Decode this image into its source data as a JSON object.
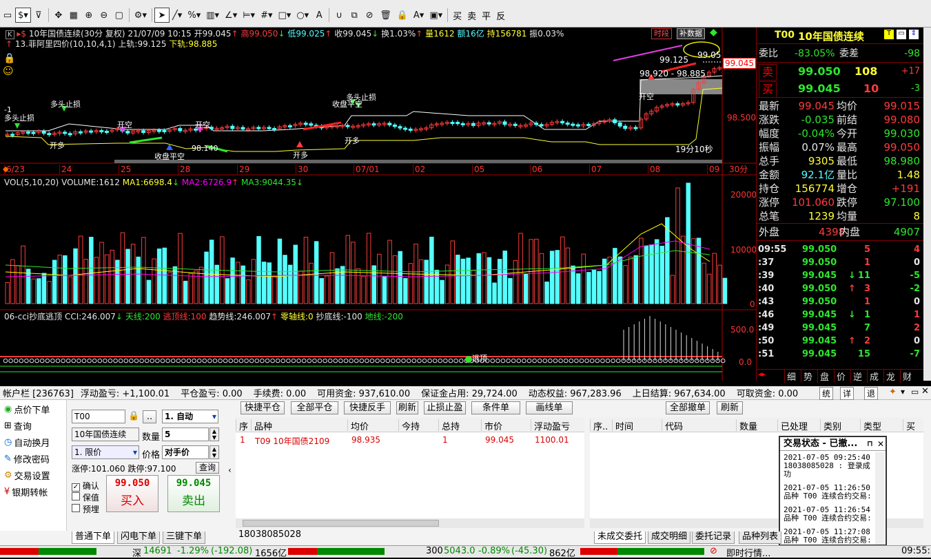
{
  "toolbar": {
    "texts": [
      "买",
      "卖",
      "平",
      "反"
    ]
  },
  "chart": {
    "title_code": "10年国债连续(30分 复权)",
    "date": "21/07/09 10:15",
    "open_lbl": "开99.045",
    "high_lbl": "高99.050",
    "low_lbl": "低99.025",
    "close_lbl": "收99.045",
    "turnover": "换1.03%",
    "vol": "量1612",
    "amount": "额16亿",
    "oi": "持156781",
    "amp": "振0.03%",
    "line2_title": "13.菲阿里四价(10,10,4,1)",
    "upper": "上轨:99.125",
    "lower": "下轨:98.885",
    "btn_timeshare": "时段",
    "btn_supplement": "补数据",
    "price_labels": [
      "99.045",
      "98.500"
    ],
    "labels_top": [
      "99.125",
      "99.05",
      "98.920 - 98.885"
    ],
    "countdown": "19分10秒",
    "dates": [
      "6/23",
      "24",
      "25",
      "28",
      "29",
      "30",
      "07/01",
      "02",
      "05",
      "06",
      "07",
      "08",
      "09"
    ],
    "period": "30分",
    "vol_title": "VOL(5,10,20) VOLUME:1612",
    "ma1": "MA1:6698.4",
    "ma2": "MA2:6726.9",
    "ma3": "MA3:9044.35",
    "vol_axis": [
      "20000",
      "10000",
      "0"
    ],
    "cci_title": "06-cci抄底逃顶 CCI:246.007",
    "cci_sky": "天线:200",
    "cci_escape": "逃顶线:100",
    "cci_trend": "趋势线:246.007",
    "cci_zero": "零轴线:0",
    "cci_bottom": "抄底线:-100",
    "cci_ground": "地线:-200",
    "cci_axis": [
      "500.0",
      "0.0"
    ],
    "signals": [
      "-1",
      "多头止损",
      "多头止损",
      "开空",
      "开空",
      "开多",
      "开多",
      "收盘平空",
      "开多",
      "收盘平空",
      "多头止损",
      "开空",
      "98.140",
      "开空",
      "收盘平空"
    ],
    "cci_mark": "逃顶"
  },
  "quote": {
    "code": "T00",
    "name": "10年国债连续",
    "weibi_lbl": "委比",
    "weibi": "-83.05%",
    "weicha_lbl": "委差",
    "weicha": "-98",
    "sell_lbl": "卖",
    "sell_price": "99.050",
    "sell_vol": "108",
    "sell_chg": "+17",
    "buy_lbl": "买",
    "buy_price": "99.045",
    "buy_vol": "10",
    "buy_chg": "-3",
    "rows": [
      [
        "最新",
        "99.045",
        "均价",
        "99.015"
      ],
      [
        "涨跌",
        "-0.035",
        "前结",
        "99.080"
      ],
      [
        "幅度",
        "-0.04%",
        "今开",
        "99.030"
      ],
      [
        "振幅",
        "0.07%",
        "最高",
        "99.050"
      ],
      [
        "总手",
        "9305",
        "最低",
        "98.980"
      ],
      [
        "金额",
        "92.1亿",
        "量比",
        "1.48"
      ],
      [
        "持仓",
        "156774",
        "增仓",
        "+191"
      ],
      [
        "涨停",
        "101.060",
        "跌停",
        "97.100"
      ],
      [
        "总笔",
        "1239",
        "均量",
        "8"
      ]
    ],
    "outer_lbl": "外盘",
    "outer": "4398",
    "inner_lbl": "内盘",
    "inner": "4907",
    "ticks": [
      [
        "09:55",
        "99.050",
        "",
        "5",
        "4"
      ],
      [
        ":37",
        "99.050",
        "",
        "1",
        "0"
      ],
      [
        ":39",
        "99.045",
        "↓",
        "11",
        "-5"
      ],
      [
        ":40",
        "99.050",
        "↑",
        "3",
        "-2"
      ],
      [
        ":43",
        "99.050",
        "",
        "1",
        "0"
      ],
      [
        ":46",
        "99.045",
        "↓",
        "1",
        "1"
      ],
      [
        ":49",
        "99.045",
        "",
        "7",
        "2"
      ],
      [
        ":50",
        "99.045",
        "↑",
        "2",
        "0"
      ],
      [
        ":51",
        "99.045",
        "",
        "15",
        "-7"
      ]
    ],
    "tabs": [
      "细",
      "势",
      "盘",
      "价",
      "逆",
      "成",
      "龙",
      "财"
    ]
  },
  "account": {
    "label": "帐户栏 [236763]",
    "float_pl": "浮动盈亏: +1,100.01",
    "close_pl": "平仓盈亏: 0.00",
    "fee": "手续费: 0.00",
    "avail": "可用资金: 937,610.00",
    "margin": "保证金占用: 29,724.00",
    "equity": "动态权益: 967,283.96",
    "last_settle": "上日结算: 967,634.00",
    "withdraw": "可取资金: 0.00",
    "btns": [
      "统",
      "详",
      "退"
    ]
  },
  "nav": [
    "点价下单",
    "查询",
    "自动换月",
    "修改密码",
    "交易设置",
    "银期转帐"
  ],
  "order": {
    "code": "T00",
    "auto": "1. 自动",
    "name": "10年国债连续",
    "qty_lbl": "数量",
    "qty": "5",
    "type": "1. 限价",
    "price_lbl": "价格",
    "price": "对手价",
    "limits": "涨停:101.060 跌停:97.100",
    "query": "查询",
    "buy_price": "99.050",
    "buy_lbl": "买入",
    "sell_price": "99.045",
    "sell_lbl": "卖出",
    "chk_confirm": "确认",
    "chk_keep": "保值",
    "chk_pre": "预埋",
    "tabs": [
      "普通下单",
      "闪电下单",
      "三键下单"
    ]
  },
  "position": {
    "btns": [
      "快捷平仓",
      "全部平仓",
      "快捷反手",
      "刷新",
      "止损止盈",
      "条件单",
      "画线单"
    ],
    "heads": [
      "序",
      "品种",
      "均价",
      "今持",
      "总持",
      "市价",
      "浮动盈亏"
    ],
    "row": [
      "1",
      "T09 10年国债2109",
      "98.935",
      "",
      "1",
      "99.045",
      "1100.01"
    ],
    "account_no": "18038085028"
  },
  "orders": {
    "btns": [
      "全部撤单",
      "刷新"
    ],
    "heads": [
      "序..",
      "时间",
      "代码",
      "数量",
      "已处理",
      "类别",
      "类型",
      "买卖"
    ],
    "tabs": [
      "未成交委托",
      "成交明细",
      "委托记录",
      "品种列表"
    ]
  },
  "popup": {
    "title": "交易状态 - 已撤...",
    "lines": [
      "2021-07-05 09:25:40",
      "18038085028 : 登录成功",
      "2021-07-05 11:26:50",
      "品种 T00 连续合约交易:",
      "2021-07-05 11:26:54",
      "品种 T00 连续合约交易:",
      "2021-07-05 11:27:08",
      "品种 T00 连续合约交易:"
    ]
  },
  "status": {
    "sz": "深",
    "sz_val": "14691",
    "sz_chg": "-1.29%",
    "sz_pts": "(-192.08)",
    "sz_amt": "1656亿",
    "i300": "300",
    "i300_val": "5043.0",
    "i300_chg": "-0.89%",
    "i300_pts": "(-45.30)",
    "i300_amt": "862亿",
    "realtime": "即时行情...",
    "time": "09:55:5"
  }
}
